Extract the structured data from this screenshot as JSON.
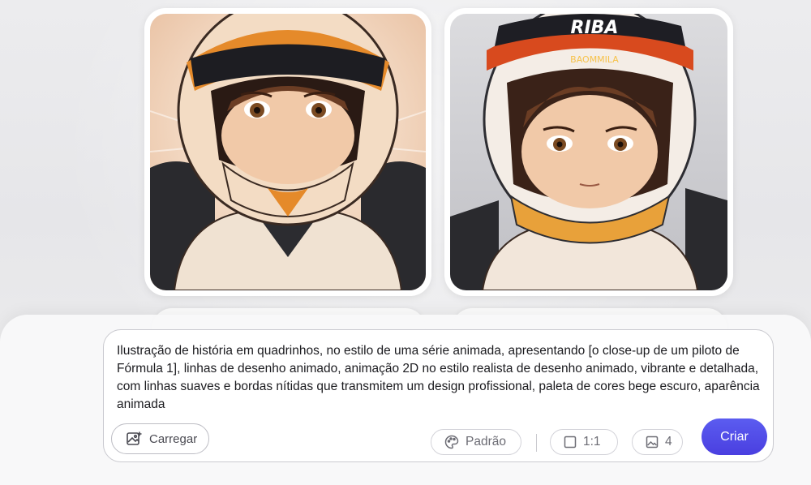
{
  "gallery": {
    "images": [
      {
        "icon": "anime-f1-pilot-helmet-closeup-1"
      },
      {
        "icon": "anime-f1-pilot-helmet-closeup-2",
        "helmet_text": "RIBA",
        "helmet_subtext": "BAOMMILA"
      }
    ]
  },
  "prompt": {
    "text": "Ilustração de história em quadrinhos, no estilo de uma série animada, apresentando [o close-up de um piloto de Fórmula 1], linhas de desenho animado, animação 2D no estilo realista de desenho animado, vibrante e detalhada, com linhas suaves e bordas nítidas que transmitem um design profissional, paleta de cores bege escuro, aparência animada"
  },
  "toolbar": {
    "upload_label": "Carregar",
    "style_label": "Padrão",
    "ratio_label": "1:1",
    "count_label": "4",
    "create_label": "Criar"
  },
  "colors": {
    "accent": "#4f46e5",
    "skin": "#f1c9a8",
    "hair": "#6b3d24",
    "suit": "#f0e2d2"
  }
}
